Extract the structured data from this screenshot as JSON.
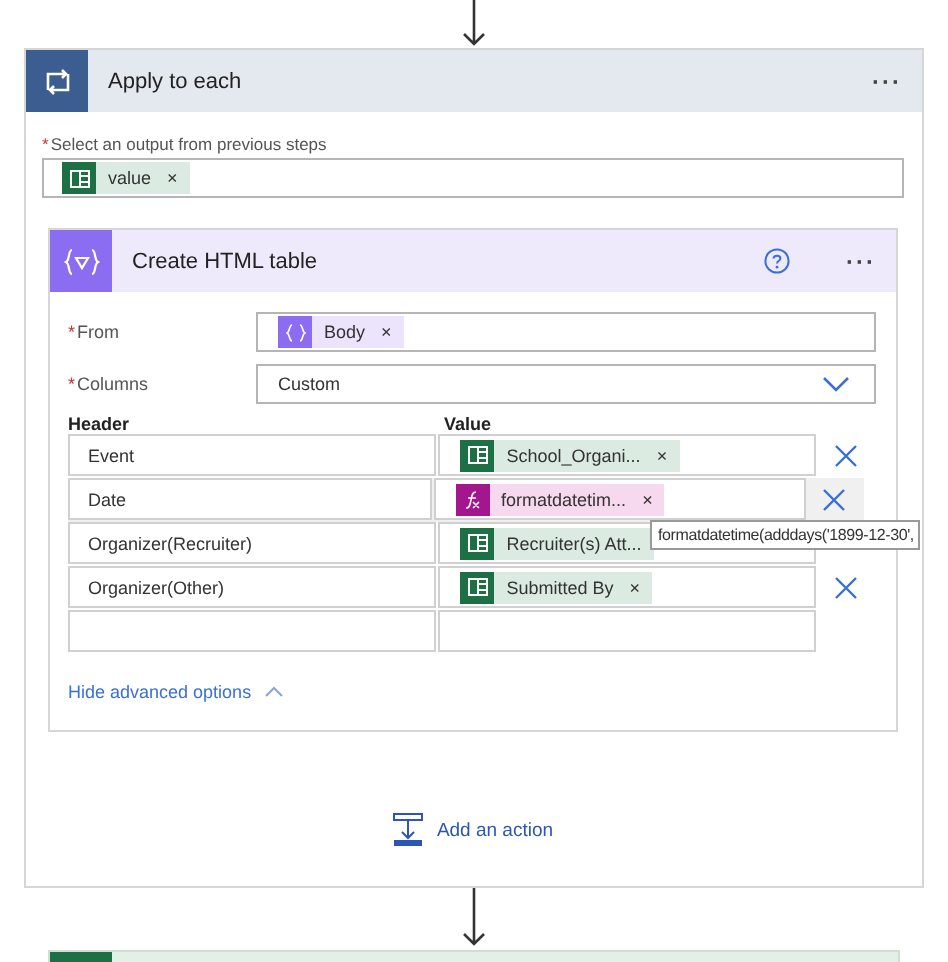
{
  "loop": {
    "title": "Apply to each",
    "more": "···",
    "required_mark": "*",
    "output_label": "Select an output from previous steps",
    "output_token": {
      "kind": "excel",
      "text": "value",
      "remove": "×"
    }
  },
  "action": {
    "title": "Create HTML table",
    "more": "···",
    "from": {
      "required_mark": "*",
      "label": "From",
      "token": {
        "kind": "variable",
        "text": "Body",
        "remove": "×"
      }
    },
    "columns": {
      "required_mark": "*",
      "label": "Columns",
      "value": "Custom"
    },
    "header_label": "Header",
    "value_label": "Value",
    "rows": [
      {
        "header": "Event",
        "token": {
          "kind": "excel",
          "text": "School_Organi...",
          "remove": "×"
        },
        "deletable": true,
        "hovered": false
      },
      {
        "header": "Date",
        "token": {
          "kind": "expression",
          "text": "formatdatetim...",
          "remove": "×"
        },
        "deletable": true,
        "hovered": true
      },
      {
        "header": "Organizer(Recruiter)",
        "token": {
          "kind": "excel",
          "text": "Recruiter(s) Att..."
        },
        "deletable": false,
        "hovered": false
      },
      {
        "header": "Organizer(Other)",
        "token": {
          "kind": "excel",
          "text": "Submitted By",
          "remove": "×"
        },
        "deletable": true,
        "hovered": false
      },
      {
        "deletable": false,
        "hovered": false
      }
    ],
    "tooltip": "formatdatetime(adddays('1899-12-30',",
    "advanced": "Hide advanced options"
  },
  "add_action": "Add an action"
}
